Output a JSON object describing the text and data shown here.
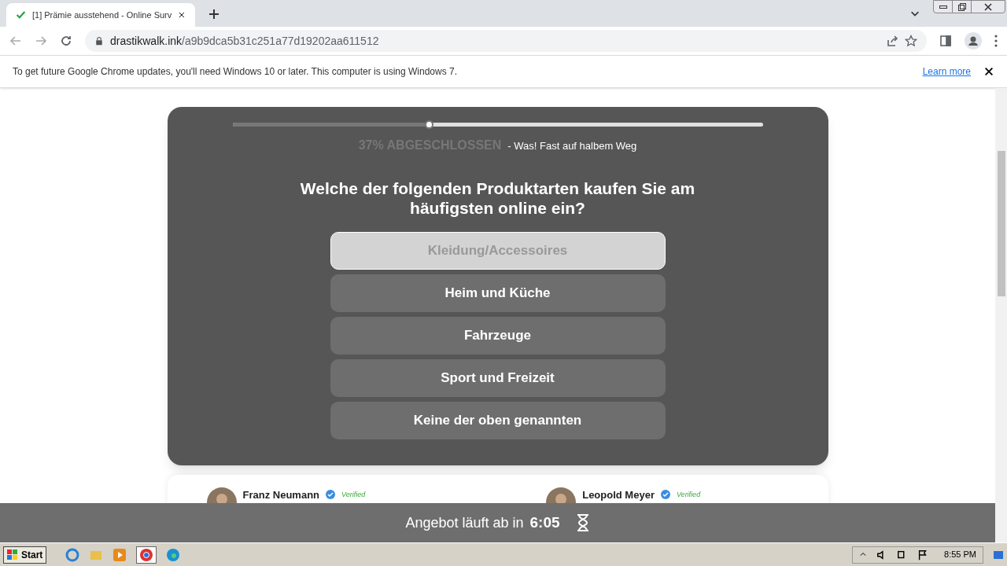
{
  "browser": {
    "tab_title": "[1] Prämie ausstehend - Online Surv",
    "url_host": "drastikwalk.ink",
    "url_path": "/a9b9dca5b31c251a77d19202aa611512"
  },
  "infobar": {
    "text": "To get future Google Chrome updates, you'll need Windows 10 or later. This computer is using Windows 7.",
    "link": "Learn more"
  },
  "survey": {
    "progress": {
      "level": 0.37,
      "label": "37% ABGESCHLOSSEN",
      "note": "- Was! Fast auf halbem Weg"
    },
    "question": "Welche der folgenden Produktarten kaufen Sie am häufigsten online ein?",
    "options": [
      {
        "label": "Kleidung/Accessoires",
        "selected": true
      },
      {
        "label": "Heim und Küche",
        "selected": false
      },
      {
        "label": "Fahrzeuge",
        "selected": false
      },
      {
        "label": "Sport und Freizeit",
        "selected": false
      },
      {
        "label": "Keine der oben genannten",
        "selected": false
      }
    ]
  },
  "reviews": [
    {
      "name": "Franz Neumann",
      "badge": "Verified"
    },
    {
      "name": "Leopold Meyer",
      "badge": "Verified"
    }
  ],
  "footer": {
    "text": "Angebot läuft ab in",
    "time": "6:05"
  },
  "taskbar": {
    "start": "Start",
    "clock": "8:55 PM"
  }
}
